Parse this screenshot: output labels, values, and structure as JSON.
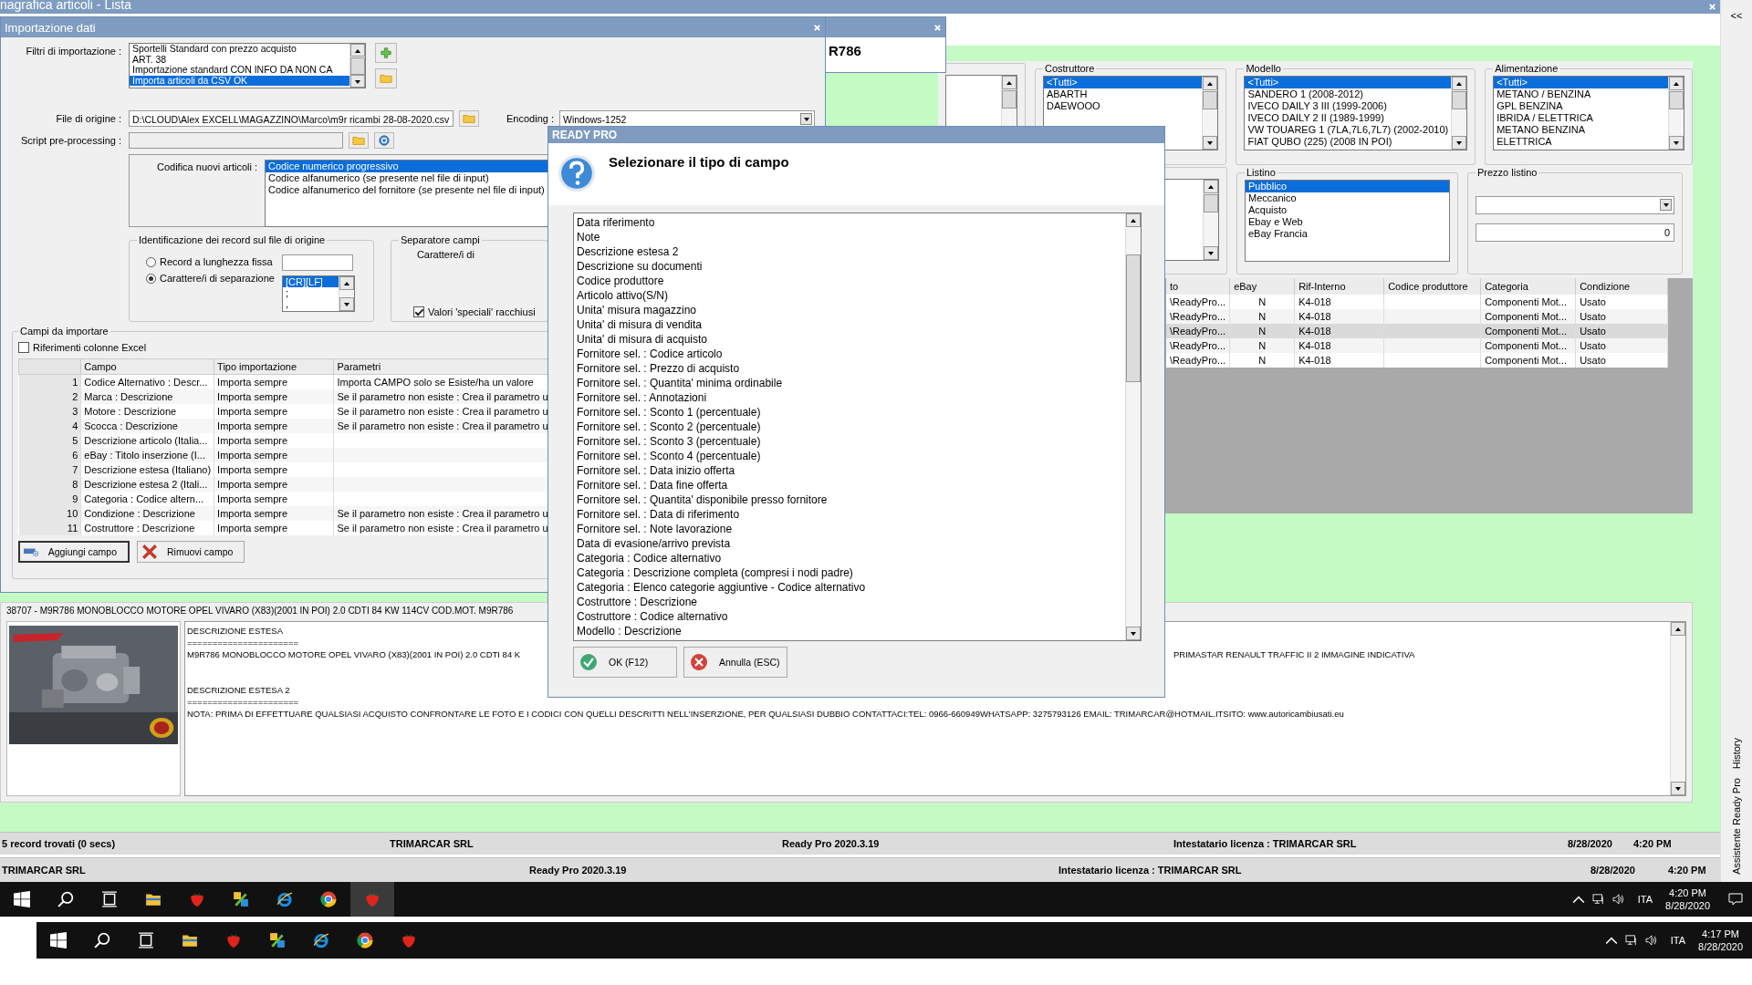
{
  "app": {
    "title": "nagrafica articoli  - Lista",
    "collapse_button": "<<",
    "side_tabs": [
      "Assistente Ready Pro",
      "History"
    ]
  },
  "record_window": {
    "code": "R786"
  },
  "filters_row1": [
    {
      "label": "Costruttore",
      "items": [
        {
          "text": "<Tutti>",
          "selected": true
        },
        {
          "text": "ABARTH",
          "selected": false
        },
        {
          "text": "DAEWOOO",
          "selected": false
        }
      ]
    },
    {
      "label": "Modello",
      "items": [
        {
          "text": "<Tutti>",
          "selected": true
        },
        {
          "text": "SANDERO 1 (2008-2012)",
          "selected": false
        },
        {
          "text": "IVECO DAILY 3 III (1999-2006)",
          "selected": false
        },
        {
          "text": "IVECO DAILY 2 II (1989-1999)",
          "selected": false
        },
        {
          "text": "VW TOUAREG 1 (7LA,7L6,7L7) (2002-2010)",
          "selected": false
        },
        {
          "text": "FIAT QUBO (225) (2008 IN POI)",
          "selected": false
        }
      ]
    },
    {
      "label": "Alimentazione",
      "items": [
        {
          "text": "<Tutti>",
          "selected": true
        },
        {
          "text": "METANO / BENZINA",
          "selected": false
        },
        {
          "text": "GPL BENZINA",
          "selected": false
        },
        {
          "text": "IBRIDA / ELETTRICA",
          "selected": false
        },
        {
          "text": "METANO BENZINA",
          "selected": false
        },
        {
          "text": "ELETTRICA",
          "selected": false
        }
      ]
    }
  ],
  "filters_row2": [
    {
      "kind": "list",
      "label": "Listino",
      "items": [
        {
          "text": "Pubblico",
          "selected": true
        },
        {
          "text": "Meccanico",
          "selected": false
        },
        {
          "text": "Acquisto",
          "selected": false
        },
        {
          "text": "Ebay e Web",
          "selected": false
        },
        {
          "text": "eBay Francia",
          "selected": false
        }
      ]
    },
    {
      "kind": "price",
      "label": "Prezzo listino",
      "value": "0"
    }
  ],
  "grid": {
    "columns": [
      "to",
      "eBay",
      "Rif-Interno",
      "Codice produttore",
      "Categoria",
      "Condizione"
    ],
    "rows": [
      {
        "cells": [
          "\\ReadyPro...",
          "N",
          "K4-018",
          "",
          "Componenti Mot...",
          "Usato"
        ],
        "selected": false
      },
      {
        "cells": [
          "\\ReadyPro...",
          "N",
          "K4-018",
          "",
          "Componenti Mot...",
          "Usato"
        ],
        "selected": false
      },
      {
        "cells": [
          "\\ReadyPro...",
          "N",
          "K4-018",
          "",
          "Componenti Mot...",
          "Usato"
        ],
        "selected": true
      },
      {
        "cells": [
          "\\ReadyPro...",
          "N",
          "K4-018",
          "",
          "Componenti Mot...",
          "Usato"
        ],
        "selected": false
      },
      {
        "cells": [
          "\\ReadyPro...",
          "N",
          "K4-018",
          "",
          "Componenti Mot...",
          "Usato"
        ],
        "selected": false
      }
    ]
  },
  "detail": {
    "header": "38707 - M9R786 MONOBLOCCO MOTORE OPEL VIVARO (X83)(2001 IN POI) 2.0 CDTI 84 KW 114CV COD.MOT. M9R786",
    "sections": [
      {
        "lines": [
          {
            "parts": [
              "DESCRIZIONE ESTESA"
            ]
          },
          {
            "parts": [
              "======================"
            ]
          },
          {
            "parts": [
              "M9R786 MONOBLOCCO MOTORE OPEL VIVARO (X83)(2001 IN POI) 2.0 CDTI 84 K",
              "PRIMASTAR RENAULT TRAFFIC II 2 IMMAGINE INDICATIVA"
            ]
          }
        ]
      },
      {
        "lines": [
          {
            "parts": [
              "DESCRIZIONE ESTESA 2"
            ]
          },
          {
            "parts": [
              "======================"
            ]
          },
          {
            "parts": [
              "NOTA: PRIMA DI EFFETTUARE QUALSIASI ACQUISTO CONFRONTARE LE FOTO E I CODICI CON QUELLI DESCRITTI NELL'INSERZIONE, PER QUALSIASI DUBBIO CONTATTACI:TEL: 0966-660949WHATSAPP: 3275793126     EMAIL: TRIMARCAR@HOTMAIL.ITSITO:  www.autoricambiusati.eu"
            ]
          }
        ]
      }
    ]
  },
  "status_bars": [
    [
      "5 record trovati (0 secs)",
      "TRIMARCAR SRL",
      "Ready Pro 2020.3.19",
      "Intestatario licenza : TRIMARCAR SRL",
      "8/28/2020",
      "4:20 PM"
    ],
    [
      "TRIMARCAR SRL",
      "Ready Pro 2020.3.19",
      "Intestatario licenza : TRIMARCAR SRL",
      "8/28/2020",
      "4:20 PM"
    ]
  ],
  "import_dialog": {
    "title": "Importazione dati",
    "filters_label": "Filtri di importazione :",
    "filters": [
      {
        "text": "Sportelli Standard con prezzo acquisto",
        "selected": false
      },
      {
        "text": "ART. 38",
        "selected": false
      },
      {
        "text": "Importazione standard CON INFO DA NON CA",
        "selected": false
      },
      {
        "text": "Importa articoli da CSV OK",
        "selected": true
      }
    ],
    "file_label": "File di origine :",
    "file_value": "D:\\CLOUD\\Alex EXCELL\\MAGAZZINO\\Marco\\m9r ricambi 28-08-2020.csv",
    "encoding_label": "Encoding :",
    "encoding_value": "Windows-1252",
    "script_label": "Script pre-processing :",
    "coding_label": "Codifica nuovi articoli :",
    "coding_options": [
      {
        "text": "Codice numerico progressivo",
        "selected": true
      },
      {
        "text": "Codice alfanumerico (se presente nel file di input)",
        "selected": false
      },
      {
        "text": "Codice alfanumerico del fornitore (se presente nel file di input)",
        "selected": false
      }
    ],
    "record_group": {
      "title": "Identificazione dei record sul file di origine",
      "options": [
        {
          "label": "Record a lunghezza fissa",
          "selected": false
        },
        {
          "label": "Carattere/i di separazione",
          "selected": true
        }
      ],
      "separators": [
        {
          "text": "[CR][LF]",
          "selected": true
        },
        {
          "text": ";",
          "selected": false
        },
        {
          "text": ",",
          "selected": false
        }
      ]
    },
    "separator_group": {
      "title": "Separatore campi",
      "label": "Carattere/i di",
      "special_values": {
        "label": "Valori 'speciali' racchiusi",
        "checked": true
      }
    },
    "fields_group": {
      "title": "Campi da importare",
      "excel_refs": {
        "label": "Riferimenti colonne Excel",
        "checked": false
      },
      "columns": [
        "",
        "Campo",
        "Tipo importazione",
        "Parametri"
      ],
      "rows": [
        [
          "1",
          "Codice Alternativo : Descr...",
          "Importa sempre",
          "Importa CAMPO solo se Esiste/ha un valore"
        ],
        [
          "2",
          "Marca : Descrizione",
          "Importa sempre",
          "Se il parametro non esiste : Crea il parametro u"
        ],
        [
          "3",
          "Motore : Descrizione",
          "Importa sempre",
          "Se il parametro non esiste : Crea il parametro u"
        ],
        [
          "4",
          "Scocca : Descrizione",
          "Importa sempre",
          "Se il parametro non esiste : Crea il parametro u"
        ],
        [
          "5",
          "Descrizione articolo (Italia...",
          "Importa sempre",
          ""
        ],
        [
          "6",
          "eBay : Titolo inserzione (I...",
          "Importa sempre",
          ""
        ],
        [
          "7",
          "Descrizione estesa (Italiano)",
          "Importa sempre",
          ""
        ],
        [
          "8",
          "Descrizione estesa 2 (Itali...",
          "Importa sempre",
          ""
        ],
        [
          "9",
          "Categoria : Codice altern...",
          "Importa sempre",
          ""
        ],
        [
          "10",
          "Condizione : Descrizione",
          "Importa sempre",
          "Se il parametro non esiste : Crea il parametro u"
        ],
        [
          "11",
          "Costruttore : Descrizione",
          "Importa sempre",
          "Se il parametro non esiste : Crea il parametro u"
        ]
      ],
      "buttons": [
        "Aggiungi campo",
        "Rimuovi campo"
      ]
    }
  },
  "field_dialog": {
    "title": "READY PRO",
    "heading": "Selezionare il tipo di campo",
    "options": [
      "Data riferimento",
      "Note",
      "Descrizione estesa 2",
      "Descrizione su documenti",
      "Codice produttore",
      "Articolo attivo(S/N)",
      "Unita' misura magazzino",
      "Unita' di misura di vendita",
      "Unita' di misura di acquisto",
      "Fornitore sel. : Codice articolo",
      "Fornitore sel. : Prezzo di acquisto",
      "Fornitore sel. : Quantita' minima ordinabile",
      "Fornitore sel. : Annotazioni",
      "Fornitore sel. : Sconto 1 (percentuale)",
      "Fornitore sel. : Sconto 2 (percentuale)",
      "Fornitore sel. : Sconto 3 (percentuale)",
      "Fornitore sel. : Sconto 4 (percentuale)",
      "Fornitore sel. : Data inizio offerta",
      "Fornitore sel. : Data fine offerta",
      "Fornitore sel. : Quantita' disponibile presso fornitore",
      "Fornitore sel. : Data di riferimento",
      "Fornitore sel. : Note lavorazione",
      "Data di evasione/arrivo prevista",
      "Categoria : Codice alternativo",
      "Categoria : Descrizione completa (compresi i nodi padre)",
      "Categoria : Elenco categorie aggiuntive - Codice alternativo",
      "Costruttore : Descrizione",
      "Costruttore : Codice alternativo",
      "Modello : Descrizione"
    ],
    "buttons": [
      {
        "kind": "ok",
        "label": "OK (F12)"
      },
      {
        "kind": "cancel",
        "label": "Annulla (ESC)"
      }
    ]
  },
  "taskbars": [
    {
      "language": "ITA",
      "time": "4:20 PM",
      "date": "8/28/2020",
      "apps": [
        {
          "kind": "windows",
          "active": false
        },
        {
          "kind": "search",
          "active": false
        },
        {
          "kind": "taskview",
          "active": false
        },
        {
          "kind": "folder",
          "active": false
        },
        {
          "kind": "strawberry",
          "active": false
        },
        {
          "kind": "tools",
          "active": false
        },
        {
          "kind": "ie",
          "active": false
        },
        {
          "kind": "chrome",
          "active": false
        },
        {
          "kind": "strawberry",
          "active": true
        }
      ]
    },
    {
      "language": "ITA",
      "time": "4:17 PM",
      "date": "8/28/2020",
      "apps": [
        {
          "kind": "windows",
          "active": false
        },
        {
          "kind": "search",
          "active": false
        },
        {
          "kind": "taskview",
          "active": false
        },
        {
          "kind": "folder",
          "active": false
        },
        {
          "kind": "strawberry",
          "active": false
        },
        {
          "kind": "tools",
          "active": false
        },
        {
          "kind": "ie",
          "active": false
        },
        {
          "kind": "chrome",
          "active": false
        },
        {
          "kind": "strawberry",
          "active": false
        }
      ]
    }
  ]
}
